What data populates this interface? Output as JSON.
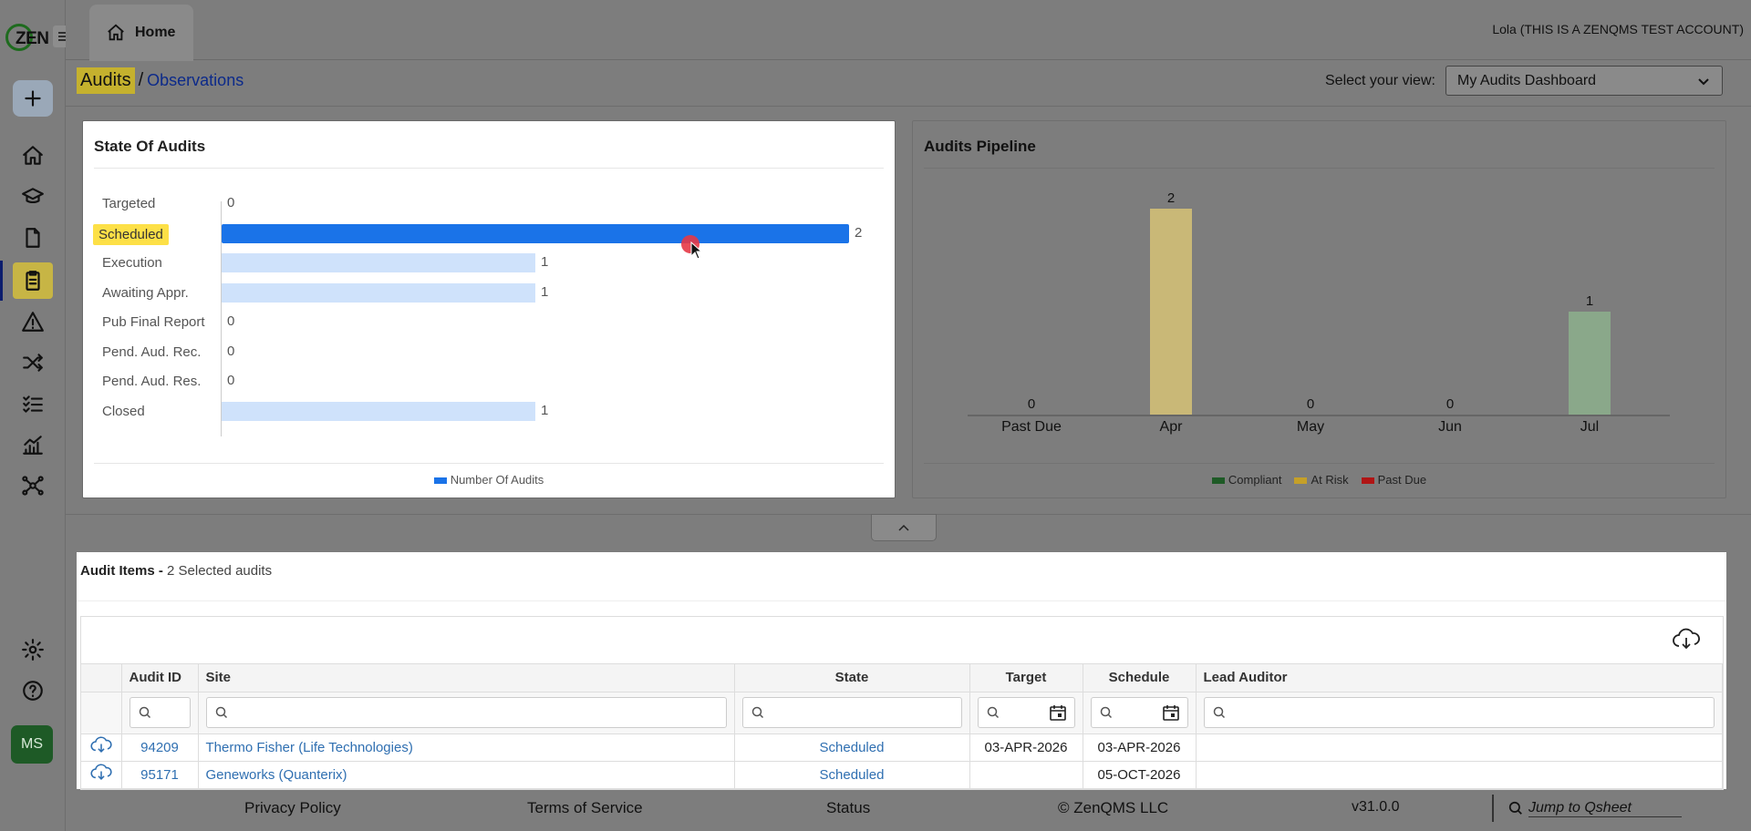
{
  "app": {
    "logo_text": "ZEN"
  },
  "topbar": {
    "home_tab": "Home",
    "user": "Lola (THIS IS A ZENQMS TEST ACCOUNT)"
  },
  "breadcrumb": {
    "current": "Audits",
    "separator": "/",
    "link": "Observations"
  },
  "view": {
    "label": "Select your view:",
    "selected": "My Audits Dashboard"
  },
  "sidebar": {
    "icons": [
      "plus-icon",
      "home-icon",
      "graduation-cap-icon",
      "document-icon",
      "clipboard-icon",
      "warning-icon",
      "shuffle-icon",
      "checklist-icon",
      "chart-icon",
      "network-icon",
      "gear-icon",
      "help-icon"
    ],
    "avatar": "MS"
  },
  "state_card": {
    "title": "State Of Audits",
    "legend": "Number Of Audits"
  },
  "pipeline_card": {
    "title": "Audits Pipeline",
    "legend": [
      "Compliant",
      "At Risk",
      "Past Due"
    ]
  },
  "chart_data": [
    {
      "type": "bar",
      "orientation": "horizontal",
      "title": "State Of Audits",
      "categories": [
        "Targeted",
        "Scheduled",
        "Execution",
        "Awaiting Appr.",
        "Pub Final Report",
        "Pend. Aud. Rec.",
        "Pend. Aud. Res.",
        "Closed"
      ],
      "series": [
        {
          "name": "Number Of Audits",
          "values": [
            0,
            2,
            1,
            1,
            0,
            0,
            0,
            1
          ]
        }
      ],
      "highlighted_category": "Scheduled",
      "colors": {
        "selected": "#1a73e8",
        "unselected": "#cfe2fb"
      },
      "xlim": [
        0,
        2
      ],
      "legend_position": "bottom"
    },
    {
      "type": "bar",
      "title": "Audits Pipeline",
      "categories": [
        "Past Due",
        "Apr",
        "May",
        "Jun",
        "Jul"
      ],
      "values": [
        0,
        2,
        0,
        0,
        1
      ],
      "series_colors": {
        "Compliant": "#1e5a26",
        "At Risk": "#c5a028",
        "Past Due": "#b01515"
      },
      "bar_colors": [
        "#b01515",
        "#c9b877",
        "#1e5a26",
        "#1e5a26",
        "#8aa88a"
      ],
      "ylim": [
        0,
        2
      ],
      "legend_position": "bottom"
    }
  ],
  "audit_items": {
    "title": "Audit Items -",
    "subtitle": "2 Selected audits",
    "columns": [
      "",
      "Audit ID",
      "Site",
      "State",
      "Target",
      "Schedule",
      "Lead Auditor"
    ],
    "rows": [
      {
        "id": "94209",
        "site": "Thermo Fisher (Life Technologies)",
        "state": "Scheduled",
        "target": "03-APR-2026",
        "schedule": "03-APR-2026",
        "lead": ""
      },
      {
        "id": "95171",
        "site": "Geneworks (Quanterix)",
        "state": "Scheduled",
        "target": "",
        "schedule": "05-OCT-2026",
        "lead": ""
      }
    ]
  },
  "footer": {
    "privacy": "Privacy Policy",
    "terms": "Terms of Service",
    "status": "Status",
    "copyright": "© ZenQMS LLC",
    "version": "v31.0.0",
    "jump_placeholder": "Jump to Qsheet"
  }
}
